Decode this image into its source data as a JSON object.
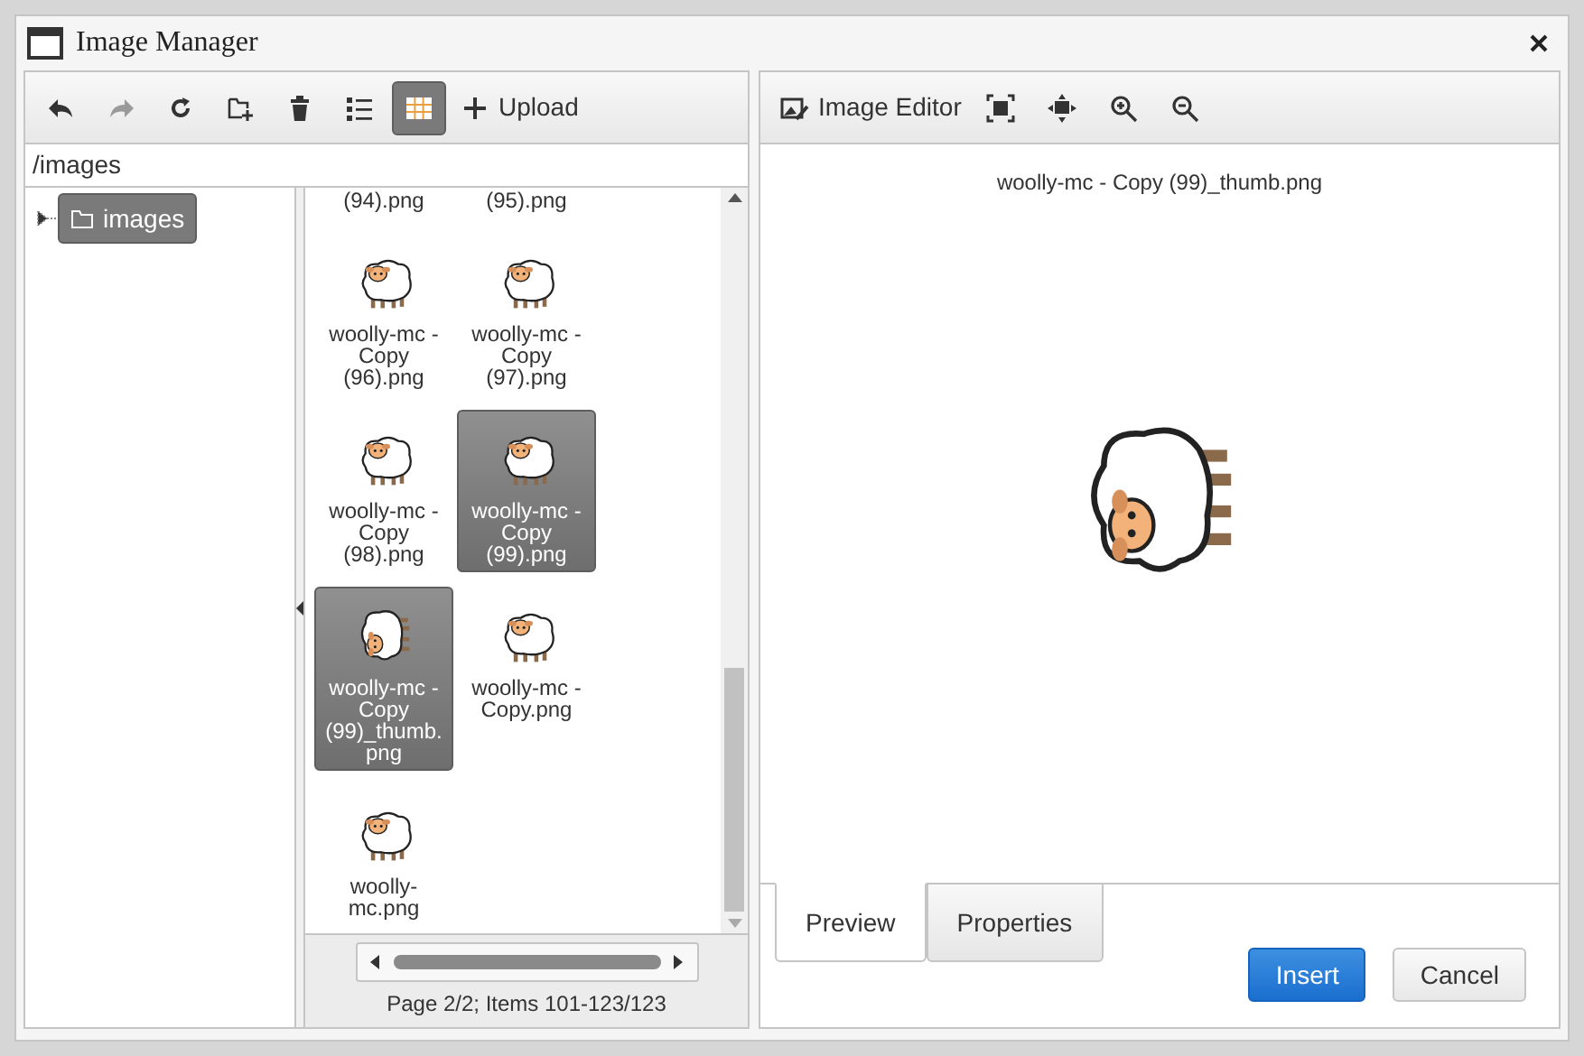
{
  "window": {
    "title": "Image Manager"
  },
  "toolbar": {
    "buttons": [
      {
        "kind": "undo",
        "disabled": false,
        "selected": false
      },
      {
        "kind": "redo",
        "disabled": true,
        "selected": false
      },
      {
        "kind": "refresh",
        "disabled": false,
        "selected": false
      },
      {
        "kind": "folder",
        "disabled": false,
        "selected": false
      },
      {
        "kind": "delete",
        "disabled": false,
        "selected": false
      },
      {
        "kind": "list",
        "disabled": false,
        "selected": false
      },
      {
        "kind": "grid",
        "disabled": false,
        "selected": true
      }
    ],
    "upload": {
      "label": "Upload"
    }
  },
  "path": "/images",
  "tree": [
    {
      "label": "images",
      "expanded": false,
      "selected": true
    }
  ],
  "files": [
    {
      "kind": "clipped",
      "label": "(94).png",
      "selected": false
    },
    {
      "kind": "clipped",
      "label": "(95).png",
      "selected": false
    },
    {
      "kind": "upright",
      "label": "woolly-mc - Copy (96).png",
      "selected": false
    },
    {
      "kind": "upright",
      "label": "woolly-mc - Copy (97).png",
      "selected": false
    },
    {
      "kind": "upright",
      "label": "woolly-mc - Copy (98).png",
      "selected": false
    },
    {
      "kind": "upright",
      "label": "woolly-mc - Copy (99).png",
      "selected": true
    },
    {
      "kind": "rotated",
      "label": "woolly-mc - Copy (99)_thumb.png",
      "selected": true
    },
    {
      "kind": "upright",
      "label": "woolly-mc - Copy.png",
      "selected": false
    },
    {
      "kind": "upright",
      "label": "woolly-mc.png",
      "selected": false
    }
  ],
  "pager": {
    "level": 1,
    "text": "Page 2/2; Items 101-123/123"
  },
  "editor_toolbar": {
    "buttons": [
      {
        "kind": "editor",
        "label": "Image Editor"
      },
      {
        "kind": "fit"
      },
      {
        "kind": "center"
      },
      {
        "kind": "zoomin"
      },
      {
        "kind": "zoomout"
      }
    ]
  },
  "preview": {
    "filename": "woolly-mc - Copy (99)_thumb.png",
    "kind": "rotated"
  },
  "tabs": [
    {
      "label": "Preview",
      "selected": true
    },
    {
      "label": "Properties",
      "selected": false
    }
  ],
  "buttons": [
    {
      "label": "Insert",
      "kind": "primary"
    },
    {
      "label": "Cancel",
      "kind": "default"
    }
  ]
}
